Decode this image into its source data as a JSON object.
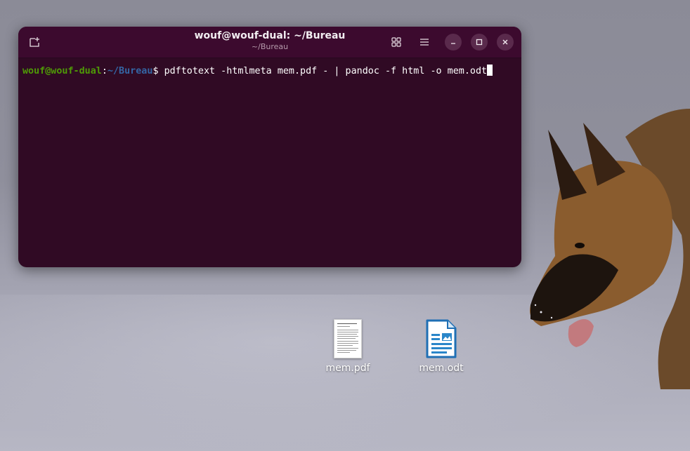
{
  "terminal": {
    "title": "wouf@wouf-dual: ~/Bureau",
    "subtitle": "~/Bureau",
    "prompt_user": "wouf@wouf-dual",
    "prompt_sep": ":",
    "prompt_path": "~/Bureau",
    "prompt_symbol": "$ ",
    "command": "pdftotext -htmlmeta mem.pdf - | pandoc -f html -o mem.odt",
    "icons": {
      "new_tab": "new-tab-icon",
      "view_grid": "grid-icon",
      "menu": "hamburger-menu-icon",
      "minimize": "minimize-icon",
      "maximize": "maximize-icon",
      "close": "close-icon"
    },
    "colors": {
      "background": "#300a24",
      "titlebar": "#3c0a2e",
      "prompt_user": "#4e9a06",
      "prompt_path": "#3465a4"
    }
  },
  "desktop": {
    "icons": [
      {
        "label": "mem.pdf",
        "type": "pdf-file-icon"
      },
      {
        "label": "mem.odt",
        "type": "odt-document-icon"
      }
    ]
  }
}
